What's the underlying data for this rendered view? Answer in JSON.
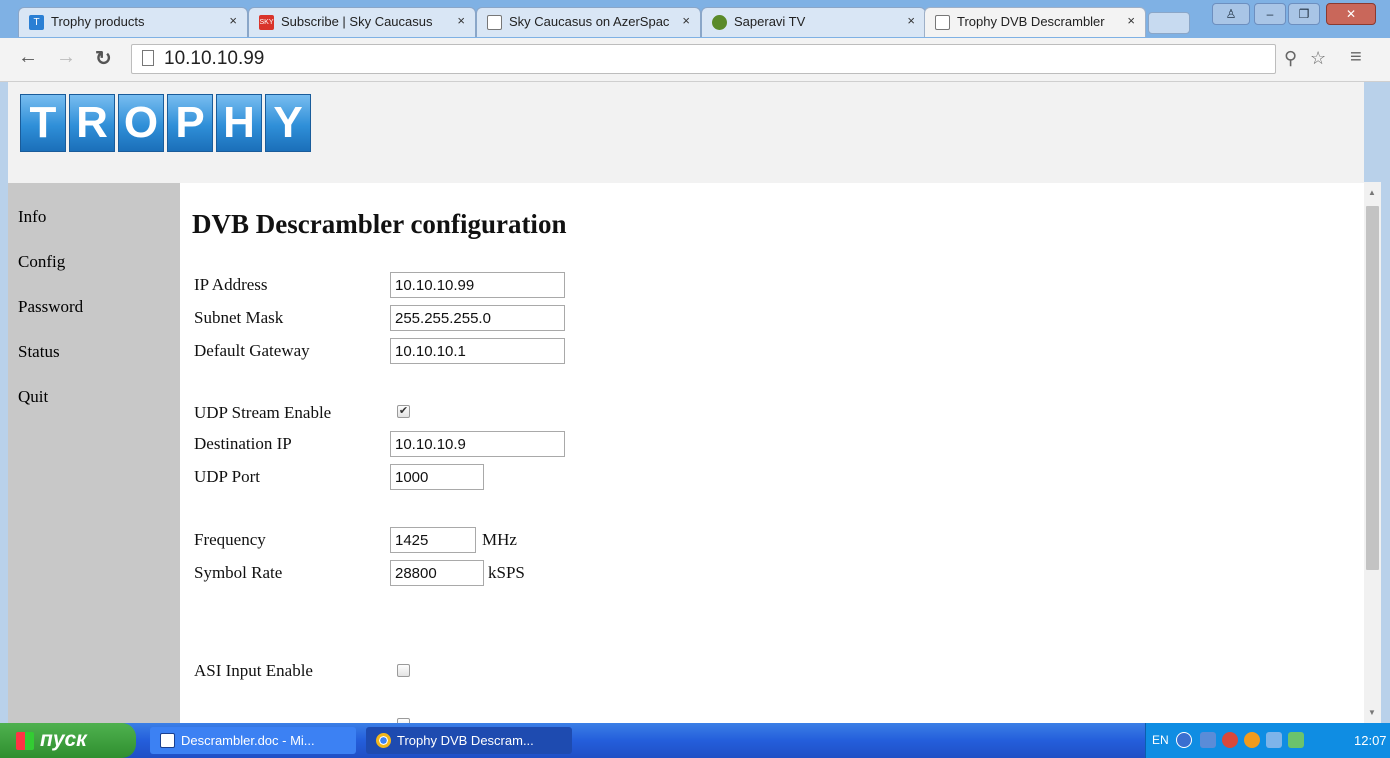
{
  "browser": {
    "tabs": [
      {
        "label": "Trophy products",
        "favicon": "trophy-favicon-icon",
        "active": false
      },
      {
        "label": "Subscribe | Sky Caucasus",
        "favicon": "sky-favicon-icon",
        "active": false
      },
      {
        "label": "Sky Caucasus on AzerSpace",
        "favicon": "page-icon",
        "active": false
      },
      {
        "label": "Saperavi TV",
        "favicon": "saperavi-favicon-icon",
        "active": false
      },
      {
        "label": "Trophy DVB Descrambler",
        "favicon": "page-icon",
        "active": true
      }
    ],
    "tab_close_glyph": "×",
    "address": "10.10.10.99",
    "colors": {
      "frame": "#7fb1e4",
      "toolbar": "#f3f3f3"
    }
  },
  "page": {
    "logo_letters": [
      "T",
      "R",
      "O",
      "P",
      "H",
      "Y"
    ],
    "sidebar_links": [
      "Info",
      "Config",
      "Password",
      "Status",
      "Quit"
    ],
    "heading": "DVB Descrambler configuration",
    "network": {
      "ip_label": "IP Address",
      "ip_value": "10.10.10.99",
      "mask_label": "Subnet Mask",
      "mask_value": "255.255.255.0",
      "gateway_label": "Default Gateway",
      "gateway_value": "10.10.10.1"
    },
    "udp": {
      "enable_label": "UDP Stream Enable",
      "enable_checked": true,
      "dest_label": "Destination IP",
      "dest_value": "10.10.10.9",
      "port_label": "UDP Port",
      "port_value": "1000"
    },
    "tuner": {
      "freq_label": "Frequency",
      "freq_value": "1425",
      "freq_unit": "MHz",
      "sr_label": "Symbol Rate",
      "sr_value": "28800",
      "sr_unit": "kSPS"
    },
    "asi": {
      "label": "ASI Input Enable",
      "checked": false
    }
  },
  "taskbar": {
    "start_label": "пуск",
    "tasks": [
      {
        "label": "Descrambler.doc - Mi...",
        "icon": "word-doc-icon"
      },
      {
        "label": "Trophy DVB Descram...",
        "icon": "chrome-icon"
      }
    ],
    "lang": "EN",
    "clock": "12:07"
  }
}
